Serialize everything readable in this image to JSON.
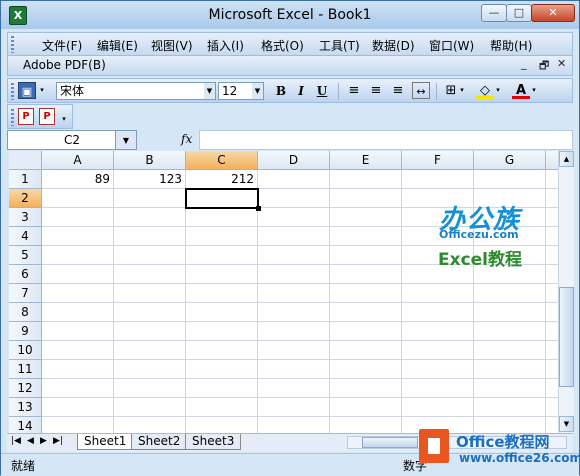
{
  "window": {
    "title": "Microsoft Excel - Book1"
  },
  "window_controls": {
    "minimize": "—",
    "maximize": "□",
    "close": "✕"
  },
  "menu": [
    {
      "label": "文件(F)"
    },
    {
      "label": "编辑(E)"
    },
    {
      "label": "视图(V)"
    },
    {
      "label": "插入(I)"
    },
    {
      "label": "格式(O)"
    },
    {
      "label": "工具(T)"
    },
    {
      "label": "数据(D)"
    },
    {
      "label": "窗口(W)"
    },
    {
      "label": "帮助(H)"
    }
  ],
  "adobe_menu": {
    "label": "Adobe PDF(B)"
  },
  "doc_controls": {
    "minimize": "_",
    "restore": "🗗",
    "close": "✕"
  },
  "format_toolbar": {
    "font": "宋体",
    "size": "12",
    "bold": "B",
    "italic": "I",
    "underline": "U"
  },
  "formula_bar": {
    "name_box": "C2",
    "fx": "fx",
    "content": ""
  },
  "grid": {
    "columns": [
      "A",
      "B",
      "C",
      "D",
      "E",
      "F",
      "G"
    ],
    "rows": [
      "1",
      "2",
      "3",
      "4",
      "5",
      "6",
      "7",
      "8",
      "9",
      "10",
      "11",
      "12",
      "13",
      "14"
    ],
    "selected_column": "C",
    "selected_row": "2",
    "cells": {
      "A1": "89",
      "B1": "123",
      "C1": "212"
    }
  },
  "watermark": {
    "logo": "办公族",
    "site": "Officezu.com",
    "subtitle": "Excel教程"
  },
  "sheets": [
    {
      "name": "Sheet1"
    },
    {
      "name": "Sheet2"
    },
    {
      "name": "Sheet3"
    }
  ],
  "status": {
    "left": "就绪",
    "mode": "数字"
  },
  "badge": {
    "title": "Office教程网",
    "url": "www.office26.com"
  }
}
